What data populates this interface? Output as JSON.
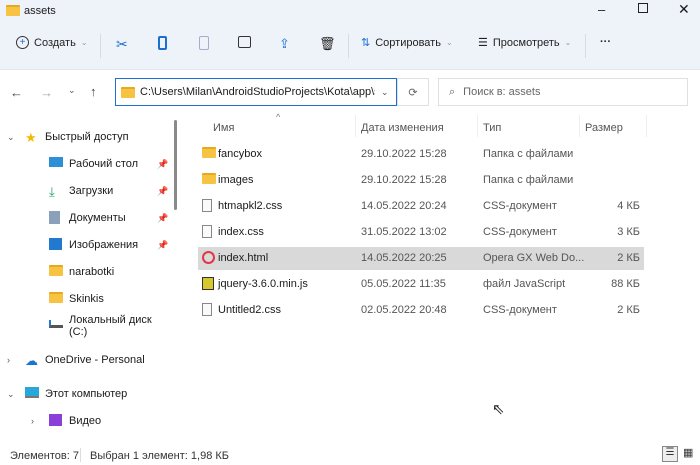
{
  "window": {
    "title": "assets"
  },
  "toolbar": {
    "create": "Создать",
    "sort": "Сортировать",
    "view": "Просмотреть",
    "more": "···"
  },
  "address": {
    "path": "C:\\Users\\Milan\\AndroidStudioProjects\\Kota\\app\\src",
    "search_placeholder": "Поиск в: assets"
  },
  "sidebar": {
    "items": [
      {
        "label": "Быстрый доступ",
        "icon": "star-icon"
      },
      {
        "label": "Рабочий стол",
        "icon": "desktop-icon",
        "pinned": true
      },
      {
        "label": "Загрузки",
        "icon": "download-icon",
        "pinned": true
      },
      {
        "label": "Документы",
        "icon": "documents-icon",
        "pinned": true
      },
      {
        "label": "Изображения",
        "icon": "pictures-icon",
        "pinned": true
      },
      {
        "label": "narabotki",
        "icon": "folder-icon"
      },
      {
        "label": "Skinkis",
        "icon": "folder-icon"
      },
      {
        "label": "Локальный диск (C:)",
        "icon": "drive-icon"
      },
      {
        "label": "OneDrive - Personal",
        "icon": "cloud-icon"
      },
      {
        "label": "Этот компьютер",
        "icon": "computer-icon"
      },
      {
        "label": "Видео",
        "icon": "video-icon"
      }
    ]
  },
  "columns": {
    "name": "Имя",
    "date": "Дата изменения",
    "type": "Тип",
    "size": "Размер"
  },
  "files": [
    {
      "name": "fancybox",
      "date": "29.10.2022 15:28",
      "type": "Папка с файлами",
      "size": "",
      "icon": "folder"
    },
    {
      "name": "images",
      "date": "29.10.2022 15:28",
      "type": "Папка с файлами",
      "size": "",
      "icon": "folder"
    },
    {
      "name": "htmapkl2.css",
      "date": "14.05.2022 20:24",
      "type": "CSS-документ",
      "size": "4 КБ",
      "icon": "css"
    },
    {
      "name": "index.css",
      "date": "31.05.2022 13:02",
      "type": "CSS-документ",
      "size": "3 КБ",
      "icon": "css"
    },
    {
      "name": "index.html",
      "date": "14.05.2022 20:25",
      "type": "Opera GX Web Do...",
      "size": "2 КБ",
      "icon": "opera",
      "selected": true
    },
    {
      "name": "jquery-3.6.0.min.js",
      "date": "05.05.2022 11:35",
      "type": "файл JavaScript",
      "size": "88 КБ",
      "icon": "js"
    },
    {
      "name": "Untitled2.css",
      "date": "02.05.2022 20:48",
      "type": "CSS-документ",
      "size": "2 КБ",
      "icon": "css"
    }
  ],
  "status": {
    "count": "Элементов: 7",
    "selection": "Выбран 1 элемент: 1,98 КБ"
  }
}
